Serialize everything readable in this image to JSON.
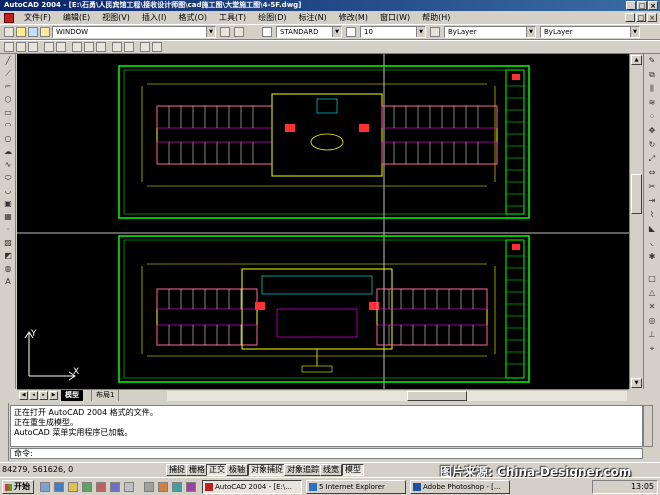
{
  "window": {
    "title": "AutoCAD 2004 - [E:\\石勇\\人民宾馆工程\\接收设计师图\\cad施工图\\大堂施工图\\4-5F.dwg]",
    "min": "_",
    "max": "□",
    "close": "×"
  },
  "menu": [
    {
      "label": "文件(F)"
    },
    {
      "label": "编辑(E)"
    },
    {
      "label": "视图(V)"
    },
    {
      "label": "插入(I)"
    },
    {
      "label": "格式(O)"
    },
    {
      "label": "工具(T)"
    },
    {
      "label": "绘图(D)"
    },
    {
      "label": "标注(N)"
    },
    {
      "label": "修改(M)"
    },
    {
      "label": "窗口(W)"
    },
    {
      "label": "帮助(H)"
    }
  ],
  "toolbar": {
    "layer": "WINDOW",
    "text_style": "STANDARD",
    "text_height": "10",
    "color": "ByLayer",
    "linetype": "ByLayer"
  },
  "tabs": {
    "model": "模型",
    "layout": "布局1"
  },
  "command": {
    "lines": [
      "正在打开 AutoCAD 2004 格式的文件。",
      "正在重生成模型。",
      "AutoCAD 菜单实用程序已加载。"
    ],
    "prompt": "命令:"
  },
  "status": {
    "coords": "84279, 561626, 0",
    "buttons": [
      {
        "label": "捕捉",
        "on": false
      },
      {
        "label": "栅格",
        "on": false
      },
      {
        "label": "正交",
        "on": true
      },
      {
        "label": "极轴",
        "on": false
      },
      {
        "label": "对象捕捉",
        "on": true
      },
      {
        "label": "对象追踪",
        "on": false
      },
      {
        "label": "线宽",
        "on": false
      },
      {
        "label": "模型",
        "on": true
      }
    ]
  },
  "watermark": "图片来源: China-Designer.com",
  "taskbar": {
    "start": "开始",
    "tasks": [
      {
        "label": "AutoCAD 2004 - [E:\\...",
        "active": true
      },
      {
        "label": "5 Internet Explorer",
        "active": false
      },
      {
        "label": "Adobe Photoshop - [...",
        "active": false
      }
    ],
    "clock": "13:05"
  },
  "ucs": {
    "x": "X",
    "y": "Y"
  },
  "colors": {
    "canvas": "#000000",
    "titlebar": "#0a246a",
    "plan_border": "#00ff00",
    "walls": "#ffff00",
    "rooms": "#ff00ff"
  }
}
